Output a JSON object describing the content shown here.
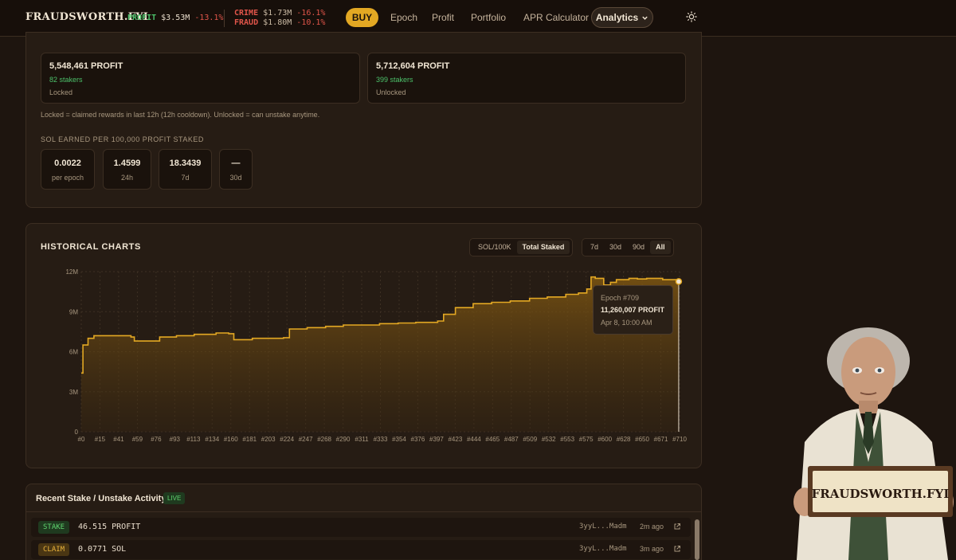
{
  "nav": {
    "brand": "FRAUDSWORTH.FYI",
    "tickers": {
      "profit": {
        "symbol": "PROFIT",
        "price": "$3.53M",
        "change": "-13.1%"
      },
      "crime": {
        "symbol": "CRIME",
        "price": "$1.73M",
        "change": "-16.1%"
      },
      "fraud": {
        "symbol": "FRAUD",
        "price": "$1.80M",
        "change": "-10.1%"
      }
    },
    "buy_label": "BUY",
    "links": [
      "Epoch",
      "Profit",
      "Portfolio",
      "APR Calculator"
    ],
    "analytics_label": "Analytics"
  },
  "pools": {
    "locked": {
      "amount": "5,548,461 PROFIT",
      "stakers": "82 stakers",
      "status": "Locked"
    },
    "unlocked": {
      "amount": "5,712,604 PROFIT",
      "stakers": "399 stakers",
      "status": "Unlocked"
    },
    "note": "Locked = claimed rewards in last 12h (12h cooldown). Unlocked = can unstake anytime."
  },
  "sol_earned": {
    "label": "SOL EARNED PER 100,000 PROFIT STAKED",
    "stats": [
      {
        "value": "0.0022",
        "label": "per epoch"
      },
      {
        "value": "1.4599",
        "label": "24h"
      },
      {
        "value": "18.3439",
        "label": "7d"
      },
      {
        "value": "—",
        "label": "30d"
      }
    ]
  },
  "historical": {
    "title": "HISTORICAL CHARTS",
    "metric_tabs": [
      "SOL/100K",
      "Total Staked"
    ],
    "metric_active": "Total Staked",
    "range_tabs": [
      "7d",
      "30d",
      "90d",
      "All"
    ],
    "range_active": "All",
    "tooltip": {
      "epoch": "Epoch #709",
      "value": "11,260,007 PROFIT",
      "time": "Apr 8, 10:00 AM"
    }
  },
  "chart_data": {
    "type": "area",
    "title": "",
    "xlabel": "",
    "ylabel": "",
    "ylim": [
      0,
      12000000
    ],
    "yticks": [
      "0",
      "3M",
      "6M",
      "9M",
      "12M"
    ],
    "xticks": [
      "#0",
      "#15",
      "#41",
      "#59",
      "#76",
      "#93",
      "#113",
      "#134",
      "#160",
      "#181",
      "#203",
      "#224",
      "#247",
      "#268",
      "#290",
      "#311",
      "#333",
      "#354",
      "#376",
      "#397",
      "#423",
      "#444",
      "#465",
      "#487",
      "#509",
      "#532",
      "#553",
      "#575",
      "#600",
      "#628",
      "#650",
      "#671",
      "#710"
    ],
    "x": [
      0,
      2,
      8,
      15,
      30,
      41,
      59,
      63,
      76,
      93,
      113,
      134,
      160,
      175,
      181,
      203,
      224,
      240,
      247,
      268,
      290,
      311,
      333,
      354,
      376,
      397,
      423,
      430,
      444,
      465,
      487,
      509,
      532,
      553,
      575,
      590,
      600,
      605,
      610,
      620,
      628,
      635,
      650,
      660,
      671,
      690,
      709
    ],
    "values": [
      4400000,
      6500000,
      7000000,
      7200000,
      7200000,
      7200000,
      7100000,
      6800000,
      6800000,
      7100000,
      7200000,
      7300000,
      7400000,
      7350000,
      6900000,
      7000000,
      7000000,
      7050000,
      7700000,
      7800000,
      7900000,
      8000000,
      8000000,
      8100000,
      8150000,
      8200000,
      8300000,
      8800000,
      9300000,
      9600000,
      9700000,
      9800000,
      10000000,
      10100000,
      10300000,
      10400000,
      10700000,
      11600000,
      11500000,
      11000000,
      11200000,
      11400000,
      11500000,
      11450000,
      11500000,
      11400000,
      11260007
    ],
    "series": [
      {
        "name": "Total Staked",
        "color": "#e3a823"
      }
    ],
    "grid": true,
    "legend": "none"
  },
  "activity": {
    "title": "Recent Stake / Unstake Activity",
    "live_label": "LIVE",
    "rows": [
      {
        "type": "STAKE",
        "amount": "46.515 PROFIT",
        "address": "3yyL...Madm",
        "time": "2m ago"
      },
      {
        "type": "CLAIM",
        "amount": "0.0771 SOL",
        "address": "3yyL...Madm",
        "time": "3m ago"
      }
    ]
  },
  "mascot": {
    "sign_text": "FRAUDSWORTH.FYI"
  },
  "colors": {
    "accent": "#e3a823",
    "positive": "#4cc06a",
    "negative": "#e0554a",
    "background": "#1e150f"
  }
}
